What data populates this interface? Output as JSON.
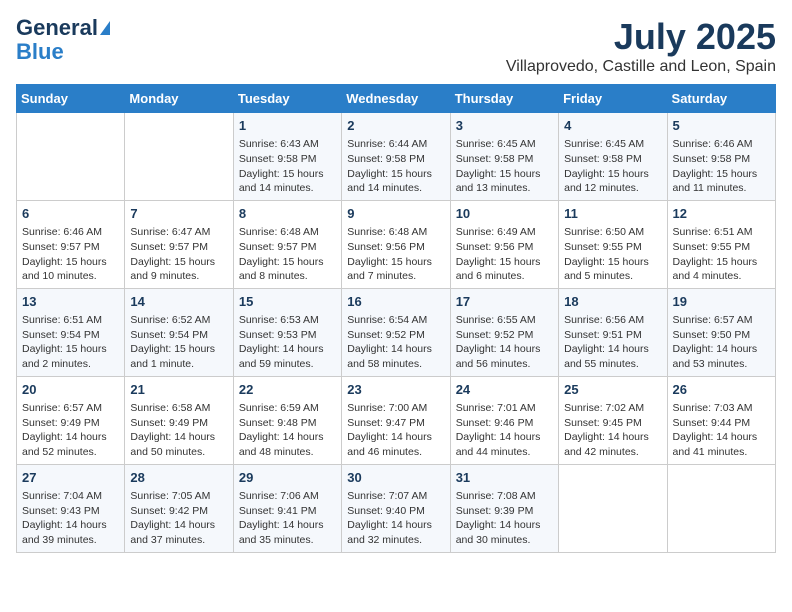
{
  "header": {
    "logo_line1": "General",
    "logo_line2": "Blue",
    "title": "July 2025",
    "subtitle": "Villaprovedo, Castille and Leon, Spain"
  },
  "weekdays": [
    "Sunday",
    "Monday",
    "Tuesday",
    "Wednesday",
    "Thursday",
    "Friday",
    "Saturday"
  ],
  "weeks": [
    [
      {
        "day": "",
        "info": ""
      },
      {
        "day": "",
        "info": ""
      },
      {
        "day": "1",
        "info": "Sunrise: 6:43 AM\nSunset: 9:58 PM\nDaylight: 15 hours and 14 minutes."
      },
      {
        "day": "2",
        "info": "Sunrise: 6:44 AM\nSunset: 9:58 PM\nDaylight: 15 hours and 14 minutes."
      },
      {
        "day": "3",
        "info": "Sunrise: 6:45 AM\nSunset: 9:58 PM\nDaylight: 15 hours and 13 minutes."
      },
      {
        "day": "4",
        "info": "Sunrise: 6:45 AM\nSunset: 9:58 PM\nDaylight: 15 hours and 12 minutes."
      },
      {
        "day": "5",
        "info": "Sunrise: 6:46 AM\nSunset: 9:58 PM\nDaylight: 15 hours and 11 minutes."
      }
    ],
    [
      {
        "day": "6",
        "info": "Sunrise: 6:46 AM\nSunset: 9:57 PM\nDaylight: 15 hours and 10 minutes."
      },
      {
        "day": "7",
        "info": "Sunrise: 6:47 AM\nSunset: 9:57 PM\nDaylight: 15 hours and 9 minutes."
      },
      {
        "day": "8",
        "info": "Sunrise: 6:48 AM\nSunset: 9:57 PM\nDaylight: 15 hours and 8 minutes."
      },
      {
        "day": "9",
        "info": "Sunrise: 6:48 AM\nSunset: 9:56 PM\nDaylight: 15 hours and 7 minutes."
      },
      {
        "day": "10",
        "info": "Sunrise: 6:49 AM\nSunset: 9:56 PM\nDaylight: 15 hours and 6 minutes."
      },
      {
        "day": "11",
        "info": "Sunrise: 6:50 AM\nSunset: 9:55 PM\nDaylight: 15 hours and 5 minutes."
      },
      {
        "day": "12",
        "info": "Sunrise: 6:51 AM\nSunset: 9:55 PM\nDaylight: 15 hours and 4 minutes."
      }
    ],
    [
      {
        "day": "13",
        "info": "Sunrise: 6:51 AM\nSunset: 9:54 PM\nDaylight: 15 hours and 2 minutes."
      },
      {
        "day": "14",
        "info": "Sunrise: 6:52 AM\nSunset: 9:54 PM\nDaylight: 15 hours and 1 minute."
      },
      {
        "day": "15",
        "info": "Sunrise: 6:53 AM\nSunset: 9:53 PM\nDaylight: 14 hours and 59 minutes."
      },
      {
        "day": "16",
        "info": "Sunrise: 6:54 AM\nSunset: 9:52 PM\nDaylight: 14 hours and 58 minutes."
      },
      {
        "day": "17",
        "info": "Sunrise: 6:55 AM\nSunset: 9:52 PM\nDaylight: 14 hours and 56 minutes."
      },
      {
        "day": "18",
        "info": "Sunrise: 6:56 AM\nSunset: 9:51 PM\nDaylight: 14 hours and 55 minutes."
      },
      {
        "day": "19",
        "info": "Sunrise: 6:57 AM\nSunset: 9:50 PM\nDaylight: 14 hours and 53 minutes."
      }
    ],
    [
      {
        "day": "20",
        "info": "Sunrise: 6:57 AM\nSunset: 9:49 PM\nDaylight: 14 hours and 52 minutes."
      },
      {
        "day": "21",
        "info": "Sunrise: 6:58 AM\nSunset: 9:49 PM\nDaylight: 14 hours and 50 minutes."
      },
      {
        "day": "22",
        "info": "Sunrise: 6:59 AM\nSunset: 9:48 PM\nDaylight: 14 hours and 48 minutes."
      },
      {
        "day": "23",
        "info": "Sunrise: 7:00 AM\nSunset: 9:47 PM\nDaylight: 14 hours and 46 minutes."
      },
      {
        "day": "24",
        "info": "Sunrise: 7:01 AM\nSunset: 9:46 PM\nDaylight: 14 hours and 44 minutes."
      },
      {
        "day": "25",
        "info": "Sunrise: 7:02 AM\nSunset: 9:45 PM\nDaylight: 14 hours and 42 minutes."
      },
      {
        "day": "26",
        "info": "Sunrise: 7:03 AM\nSunset: 9:44 PM\nDaylight: 14 hours and 41 minutes."
      }
    ],
    [
      {
        "day": "27",
        "info": "Sunrise: 7:04 AM\nSunset: 9:43 PM\nDaylight: 14 hours and 39 minutes."
      },
      {
        "day": "28",
        "info": "Sunrise: 7:05 AM\nSunset: 9:42 PM\nDaylight: 14 hours and 37 minutes."
      },
      {
        "day": "29",
        "info": "Sunrise: 7:06 AM\nSunset: 9:41 PM\nDaylight: 14 hours and 35 minutes."
      },
      {
        "day": "30",
        "info": "Sunrise: 7:07 AM\nSunset: 9:40 PM\nDaylight: 14 hours and 32 minutes."
      },
      {
        "day": "31",
        "info": "Sunrise: 7:08 AM\nSunset: 9:39 PM\nDaylight: 14 hours and 30 minutes."
      },
      {
        "day": "",
        "info": ""
      },
      {
        "day": "",
        "info": ""
      }
    ]
  ]
}
